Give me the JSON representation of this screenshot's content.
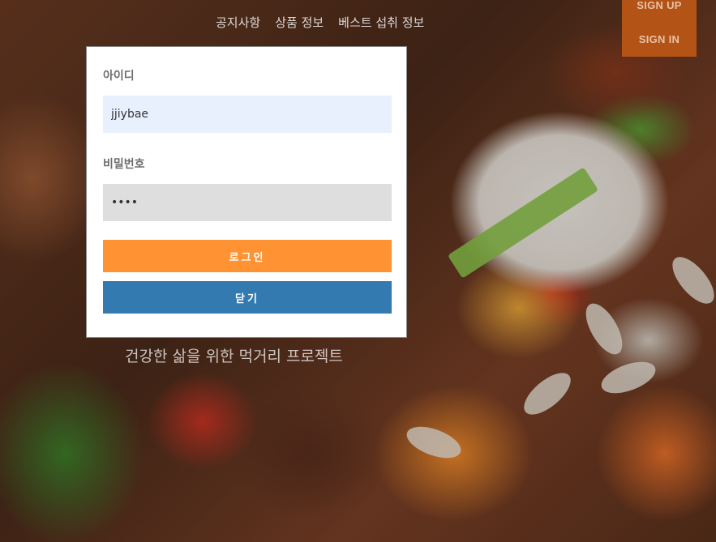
{
  "nav": {
    "items": [
      "공지사항",
      "상품 정보",
      "베스트 섭취 정보"
    ],
    "sign_up": "SIGN UP",
    "sign_in": "SIGN IN"
  },
  "hero": {
    "tagline": "건강한 삶을 위한 먹거리 프로젝트"
  },
  "login_modal": {
    "id_label": "아이디",
    "id_value": "jjiybae",
    "password_label": "비밀번호",
    "password_value": "1234",
    "login_button": "로그인",
    "close_button": "닫기"
  },
  "colors": {
    "login_button": "#ff9232",
    "close_button": "#337ab1",
    "auth_box": "#b35316",
    "id_input_bg": "#e8f0fe"
  }
}
